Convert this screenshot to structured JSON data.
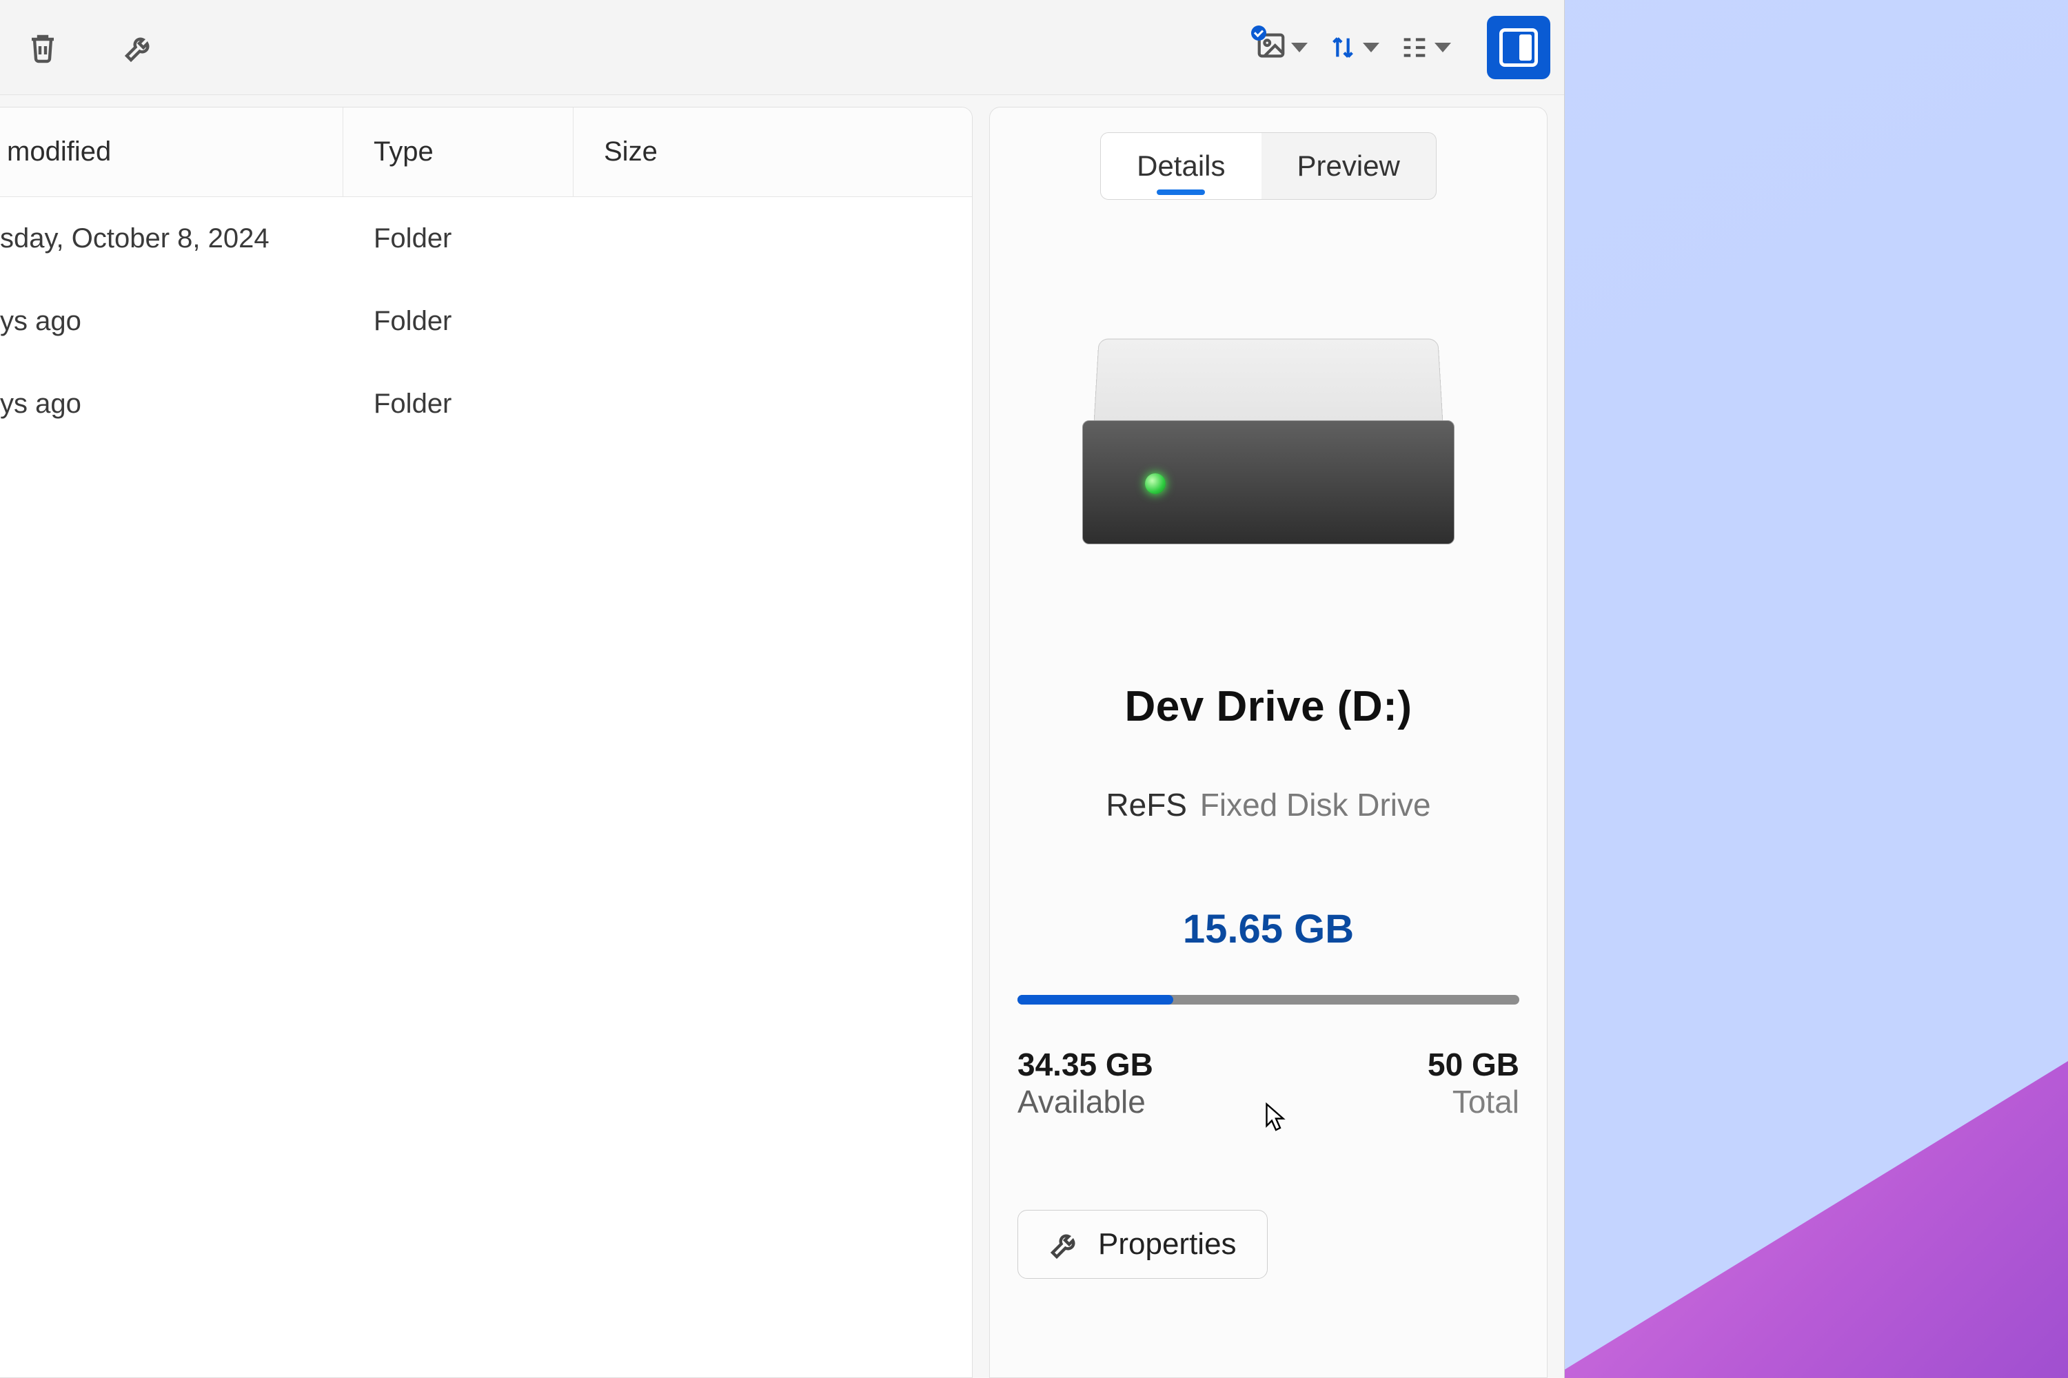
{
  "toolbar": {
    "delete_tip": "Delete",
    "properties_tip": "Properties",
    "thumbnails_tip": "Thumbnails",
    "sort_tip": "Sort",
    "view_tip": "View",
    "pane_tip": "Details pane"
  },
  "columns": {
    "modified": "modified",
    "type": "Type",
    "size": "Size"
  },
  "rows": [
    {
      "modified": "sday, October 8, 2024",
      "type": "Folder",
      "size": ""
    },
    {
      "modified": "ys ago",
      "type": "Folder",
      "size": ""
    },
    {
      "modified": "ys ago",
      "type": "Folder",
      "size": ""
    }
  ],
  "details": {
    "tabs": {
      "details": "Details",
      "preview": "Preview"
    },
    "drive_name": "Dev Drive (D:)",
    "filesystem": "ReFS",
    "drive_type": "Fixed Disk Drive",
    "used": "15.65 GB",
    "available_value": "34.35 GB",
    "available_label": "Available",
    "total_value": "50 GB",
    "total_label": "Total",
    "used_percent": 31,
    "properties_label": "Properties"
  }
}
